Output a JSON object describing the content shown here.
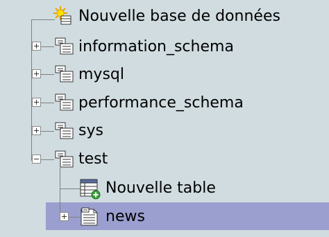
{
  "tree": {
    "new_database": {
      "label": "Nouvelle base de données",
      "icon": "new-database-icon"
    },
    "databases": [
      {
        "label": "information_schema",
        "icon": "database-icon",
        "expander": "plus"
      },
      {
        "label": "mysql",
        "icon": "database-icon",
        "expander": "plus"
      },
      {
        "label": "performance_schema",
        "icon": "database-icon",
        "expander": "plus"
      },
      {
        "label": "sys",
        "icon": "database-icon",
        "expander": "plus"
      },
      {
        "label": "test",
        "icon": "database-icon",
        "expander": "minus"
      }
    ],
    "test_children": {
      "new_table": {
        "label": "Nouvelle table",
        "icon": "new-table-icon"
      },
      "tables": [
        {
          "label": "news",
          "icon": "table-icon",
          "expander": "plus",
          "selected": true
        }
      ]
    }
  },
  "colors": {
    "background": "#d0dce0",
    "selected_row": "#9a9fcf",
    "connector": "#7f7f7f"
  }
}
